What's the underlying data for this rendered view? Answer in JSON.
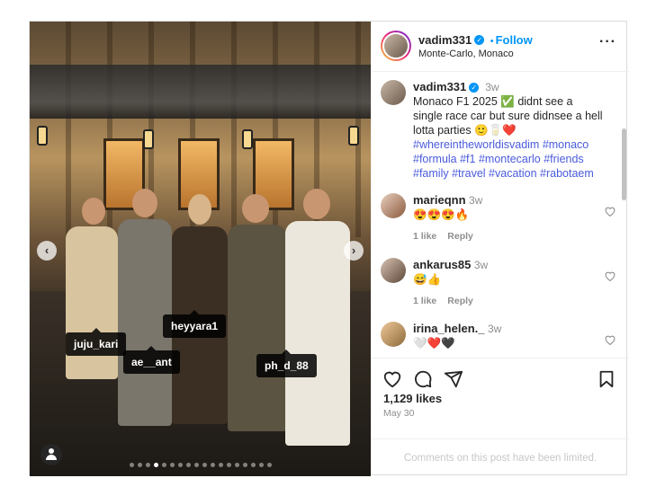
{
  "post": {
    "username": "vadim331",
    "follow_label": "Follow",
    "dot_sep": "•",
    "location": "Monte-Carlo, Monaco",
    "more_label": "···",
    "caption": {
      "username": "vadim331",
      "time": "3w",
      "text": "Monaco F1 2025 ✅ didnt see a single race car but sure didnsee a hell lotta parties 🙂🥛❤️",
      "hashtags": "#whereintheworldisvadim #monaco #formula #f1 #montecarlo #friends #family #travel #vacation #rabotaem"
    },
    "comments": [
      {
        "username": "marieqnn",
        "time": "3w",
        "text": "😍😍😍🔥",
        "likes_label": "1 like",
        "reply_label": "Reply"
      },
      {
        "username": "ankarus85",
        "time": "3w",
        "text": "😅👍",
        "likes_label": "1 like",
        "reply_label": "Reply"
      },
      {
        "username": "irina_helen._",
        "time": "3w",
        "text": "🤍❤️🖤"
      }
    ],
    "likes": "1,129 likes",
    "date": "May 30",
    "comments_limited": "Comments on this post have been limited."
  },
  "photo": {
    "tags": [
      "juju_kari",
      "ae__ant",
      "heyyara1",
      "ph_d_88"
    ],
    "carousel": {
      "total": 18,
      "active_index": 3
    },
    "prev_label": "‹",
    "next_label": "›"
  },
  "icons": {
    "verified": "verified-badge-icon",
    "heart": "heart-icon",
    "comment": "comment-icon",
    "share": "share-icon",
    "save": "bookmark-icon",
    "user_tags": "user-tags-icon"
  },
  "colors": {
    "accent": "#0095f6",
    "hashtag": "#4a5bdc",
    "muted": "#8e8e8e"
  }
}
